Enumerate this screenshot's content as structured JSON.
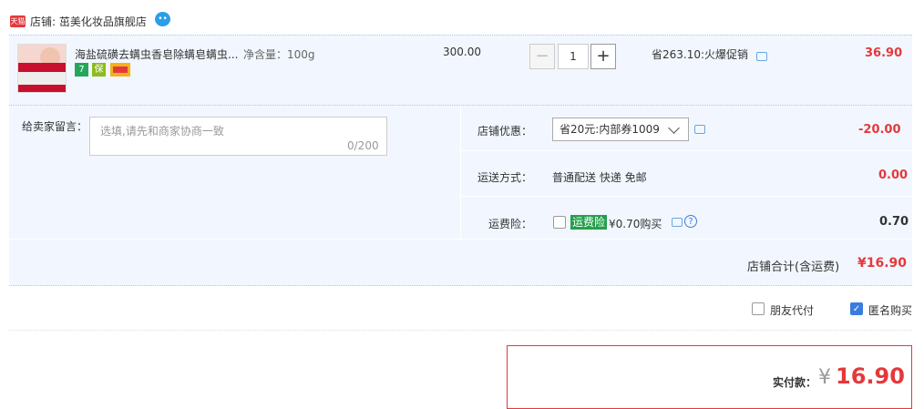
{
  "shop": {
    "badge": "天猫",
    "label": "店铺: 茁美化妆品旗舰店"
  },
  "item": {
    "title": "海盐硫磺去螨虫香皂除螨皂螨虫...",
    "spec": "净含量：100g",
    "service_badges": [
      {
        "icon": "seven-day-return-icon",
        "text": "7",
        "color": "#25a65b"
      },
      {
        "icon": "shield-icon",
        "text": "保",
        "color": "#8dbb1f"
      },
      {
        "icon": "credit-card-icon",
        "text": "",
        "color": "#f6b11a"
      }
    ],
    "price": "300.00",
    "quantity": "1",
    "minus": "−",
    "plus": "+",
    "promo": "省263.10:火爆促销",
    "total": "36.90"
  },
  "message": {
    "label": "给卖家留言：",
    "placeholder": "选填,请先和商家协商一致",
    "count": "0/200"
  },
  "coupon": {
    "label": "店铺优惠：",
    "selected": "省20元:内部券1009",
    "value": "-20.00"
  },
  "shipping": {
    "label": "运送方式：",
    "method": "普通配送 快递 免邮",
    "value": "0.00"
  },
  "insurance": {
    "label": "运费险：",
    "tag": "运费险",
    "text": "¥0.70购买",
    "help": "?",
    "value": "0.70"
  },
  "shop_total": {
    "label": "店铺合计(含运费)",
    "value": "¥16.90"
  },
  "options": {
    "friend_pay": "朋友代付",
    "anonymous": "匿名购买",
    "anonymous_checked": true,
    "friend_pay_checked": false
  },
  "payment": {
    "label": "实付款：",
    "currency": "¥",
    "value": "16.90"
  },
  "colors": {
    "accent_red": "#e4393c",
    "panel_blue": "#f2f7ff",
    "link_blue": "#3b7ddd"
  }
}
